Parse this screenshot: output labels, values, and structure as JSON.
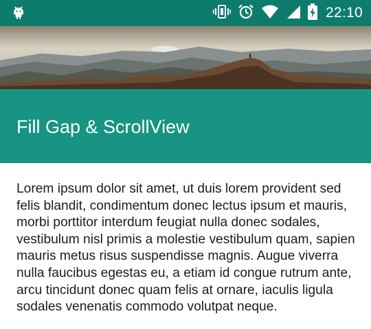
{
  "status_bar": {
    "time": "22:10",
    "icons": [
      "android-icon",
      "vibrate-icon",
      "alarm-icon",
      "wifi-icon",
      "signal-icon",
      "battery-charging-icon"
    ]
  },
  "header": {
    "image": "mountain-landscape-banner",
    "title": "Fill Gap & ScrollView"
  },
  "content": {
    "body": "Lorem ipsum dolor sit amet, ut duis lorem provident sed felis blandit, condimentum donec lectus ipsum et mauris, morbi porttitor interdum feugiat nulla donec sodales, vestibulum nisl primis a molestie vestibulum quam, sapien mauris metus risus suspendisse magnis. Augue viverra nulla faucibus egestas eu, a etiam id congue rutrum ante, arcu tincidunt donec quam felis at ornare, iaculis ligula sodales venenatis commodo volutpat neque."
  },
  "colors": {
    "status_bar": "#0e7c6d",
    "toolbar": "#179484",
    "title_text": "#ffffff",
    "body_text": "#1c1c1c"
  }
}
